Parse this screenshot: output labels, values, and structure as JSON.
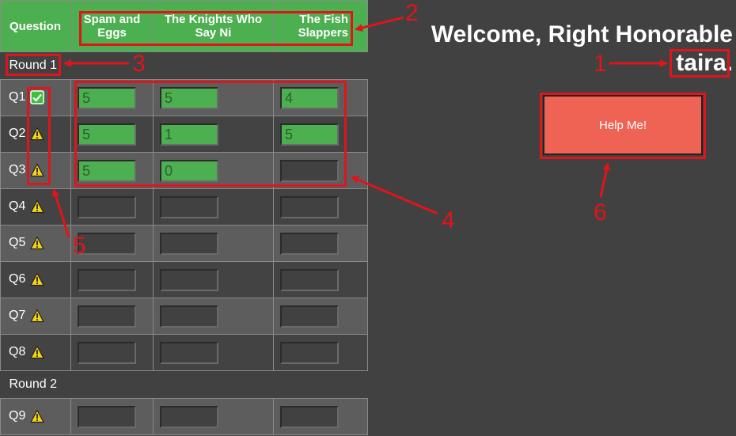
{
  "table": {
    "question_header": "Question",
    "teams": [
      "Spam and Eggs",
      "The Knights Who Say Ni",
      "The Fish Slappers"
    ],
    "rounds": [
      {
        "label": "Round 1",
        "questions": [
          {
            "label": "Q1",
            "status": "check-icon",
            "scores": [
              "5",
              "5",
              "4"
            ]
          },
          {
            "label": "Q2",
            "status": "warning-icon",
            "scores": [
              "5",
              "1",
              "5"
            ]
          },
          {
            "label": "Q3",
            "status": "warning-icon",
            "scores": [
              "5",
              "0",
              ""
            ]
          },
          {
            "label": "Q4",
            "status": "warning-icon",
            "scores": [
              "",
              "",
              ""
            ]
          },
          {
            "label": "Q5",
            "status": "warning-icon",
            "scores": [
              "",
              "",
              ""
            ]
          },
          {
            "label": "Q6",
            "status": "warning-icon",
            "scores": [
              "",
              "",
              ""
            ]
          },
          {
            "label": "Q7",
            "status": "warning-icon",
            "scores": [
              "",
              "",
              ""
            ]
          },
          {
            "label": "Q8",
            "status": "warning-icon",
            "scores": [
              "",
              "",
              ""
            ]
          }
        ]
      },
      {
        "label": "Round 2",
        "questions": [
          {
            "label": "Q9",
            "status": "warning-icon",
            "scores": [
              "",
              "",
              ""
            ]
          }
        ]
      }
    ]
  },
  "welcome": {
    "greeting": "Welcome, Right Honorable",
    "username": "taira",
    "punct": "."
  },
  "help_button": {
    "label": "Help Me!"
  },
  "annotations": [
    "1",
    "2",
    "3",
    "4",
    "5",
    "6"
  ],
  "colors": {
    "accent": "#4caf50",
    "help": "#ef6354",
    "annotation": "#e0141b",
    "background": "#414141"
  }
}
